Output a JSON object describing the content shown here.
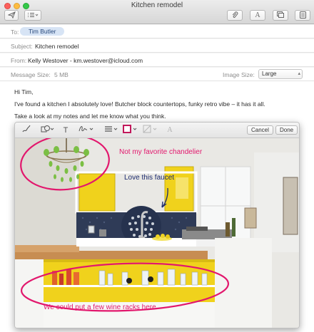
{
  "window": {
    "title": "Kitchen remodel"
  },
  "toolbar": {
    "send_icon": "paper-plane-icon",
    "list_icon": "list-icon",
    "attach_icon": "paperclip-icon",
    "format_icon": "text-format-icon",
    "browser_icon": "window-icon",
    "photo_icon": "photo-browser-icon",
    "format_label": "A"
  },
  "header": {
    "to_label": "To:",
    "to_recipient": "Tim Butler",
    "subject_label": "Subject:",
    "subject_value": "Kitchen remodel",
    "from_label": "From:",
    "from_value": "Kelly Westover - km.westover@icloud.com",
    "size_label": "Message Size:",
    "size_value": "5 MB",
    "image_size_label": "Image Size:",
    "image_size_value": "Large"
  },
  "body": {
    "greeting": "Hi Tim,",
    "line1": "I've found a kitchen I absolutely love! Butcher block countertops, funky retro vibe – it has it all.",
    "line2": "Take a look at my notes and let me know what you think."
  },
  "markup": {
    "cancel_label": "Cancel",
    "done_label": "Done",
    "tools": [
      "sketch-icon",
      "shapes-icon",
      "text-icon",
      "signature-icon",
      "line-style-icon",
      "border-color-icon",
      "fill-color-icon",
      "text-style-icon"
    ],
    "text_tool_label": "T",
    "text_style_label": "A",
    "shape_color": "#c2185b",
    "annotations": {
      "chandelier": "Not my favorite chandelier",
      "faucet": "Love this faucet",
      "wine": "We could put a few wine racks here"
    }
  },
  "colors": {
    "annotation_pink": "#e2176d",
    "annotation_navy": "#1c2a6e",
    "chip_blue": "#d7e4f5",
    "kitchen_yellow": "#f0d21c"
  }
}
